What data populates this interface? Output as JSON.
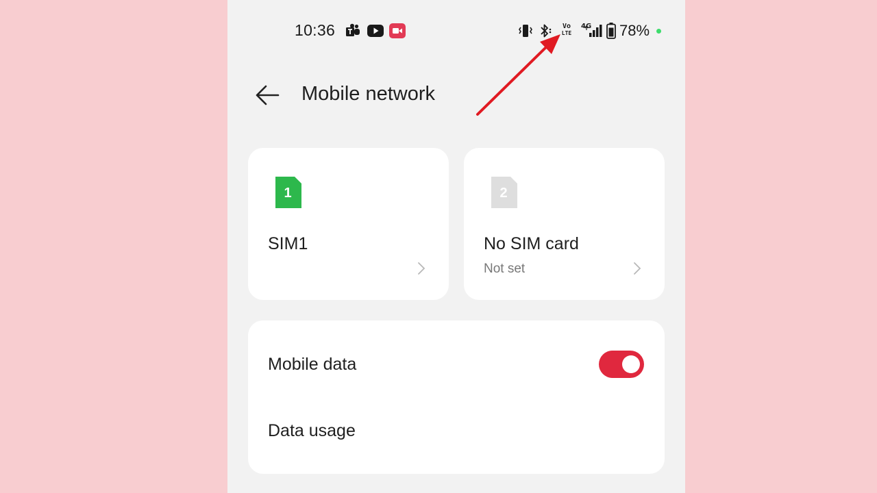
{
  "status_bar": {
    "time": "10:36",
    "battery_percent": "78%",
    "network_badge": "4G",
    "volte_line1": "Vo",
    "volte_line2": "LTE",
    "notification_icons": [
      "teams-icon",
      "youtube-icon",
      "screen-recorder-icon"
    ],
    "system_icons": [
      "vibrate-icon",
      "bluetooth-icon",
      "volte-icon",
      "signal-icon",
      "battery-icon"
    ]
  },
  "header": {
    "title": "Mobile network"
  },
  "sim_cards": [
    {
      "badge": "1",
      "label": "SIM1",
      "subtitle": "",
      "color": "#2db84c"
    },
    {
      "badge": "2",
      "label": "No SIM card",
      "subtitle": "Not set",
      "color": "#dddddd"
    }
  ],
  "settings": {
    "mobile_data_label": "Mobile data",
    "mobile_data_enabled": true,
    "data_usage_label": "Data usage"
  },
  "colors": {
    "accent": "#e0283e",
    "annotation_arrow": "#e01a22",
    "background": "#f8cdd0"
  }
}
